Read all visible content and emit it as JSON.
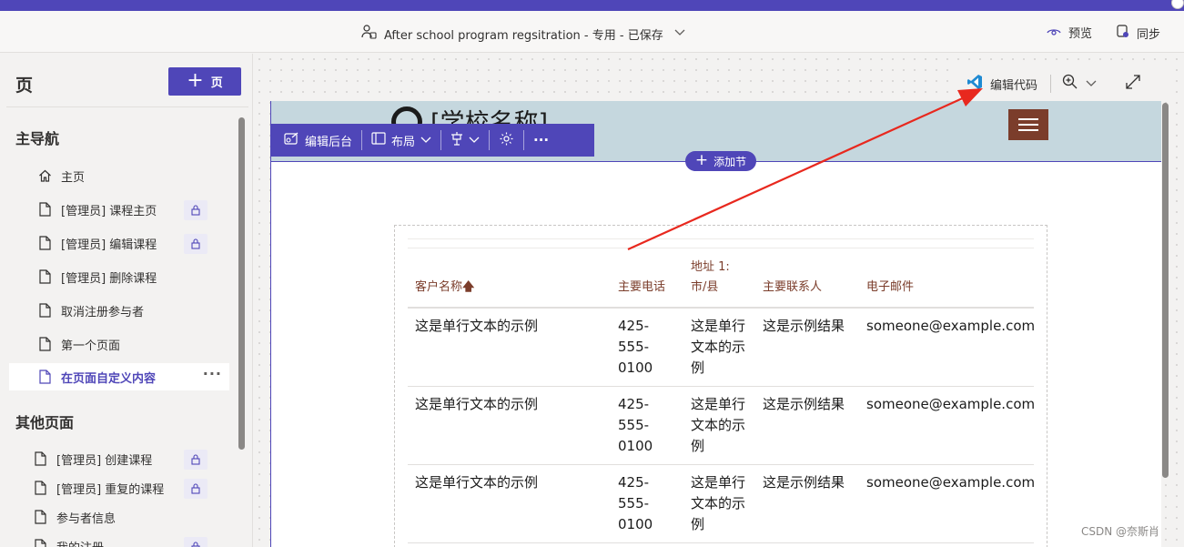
{
  "window": {
    "title": "After school program regsitration - 专用 - 已保存",
    "preview_label": "预览",
    "sync_label": "同步"
  },
  "pages_pane": {
    "heading": "页",
    "add_page_label": "页",
    "main_nav_title": "主导航",
    "main_nav_items": [
      {
        "label": "主页",
        "icon": "home-icon",
        "locked": false
      },
      {
        "label": "[管理员] 课程主页",
        "icon": "page-icon",
        "locked": true
      },
      {
        "label": "[管理员] 编辑课程",
        "icon": "page-icon",
        "locked": true
      },
      {
        "label": "[管理员] 删除课程",
        "icon": "page-icon",
        "locked": false
      },
      {
        "label": "取消注册参与者",
        "icon": "page-icon",
        "locked": false
      },
      {
        "label": "第一个页面",
        "icon": "page-icon",
        "locked": false
      },
      {
        "label": "在页面自定义内容",
        "icon": "page-icon",
        "locked": false,
        "selected": true
      }
    ],
    "more_label": "···",
    "other_pages_title": "其他页面",
    "other_pages_items": [
      {
        "label": "[管理员] 创建课程",
        "locked": true
      },
      {
        "label": "[管理员] 重复的课程",
        "locked": true
      },
      {
        "label": "参与者信息",
        "locked": false
      },
      {
        "label": "我的注册",
        "locked": true
      }
    ]
  },
  "canvas_toolbar": {
    "edit_code_label": "编辑代码"
  },
  "site": {
    "school_name": "[学校名称]",
    "section_toolbar": {
      "edit_backend": "编辑后台",
      "layout": "布局",
      "more": "···"
    },
    "add_section_label": "添加节"
  },
  "list": {
    "columns": [
      "客户名称",
      "主要电话",
      "地址 1:",
      "市/县",
      "主要联系人",
      "电子邮件"
    ],
    "sort_indicator": "🡅",
    "rows": [
      {
        "name": "这是单行文本的示例",
        "phone": "425-555-0100",
        "city": "这是单行文本的示例",
        "contact": "这是示例结果",
        "email": "someone@example.com"
      },
      {
        "name": "这是单行文本的示例",
        "phone": "425-555-0100",
        "city": "这是单行文本的示例",
        "contact": "这是示例结果",
        "email": "someone@example.com"
      },
      {
        "name": "这是单行文本的示例",
        "phone": "425-555-0100",
        "city": "这是单行文本的示例",
        "contact": "这是示例结果",
        "email": "someone@example.com"
      }
    ]
  },
  "watermark": "CSDN @奈斯肖",
  "colors": {
    "brand": "#4f46b8",
    "header_bg": "#c5d7de",
    "accent_brown": "#7b3d2b",
    "arrow_red": "#e8281e"
  }
}
